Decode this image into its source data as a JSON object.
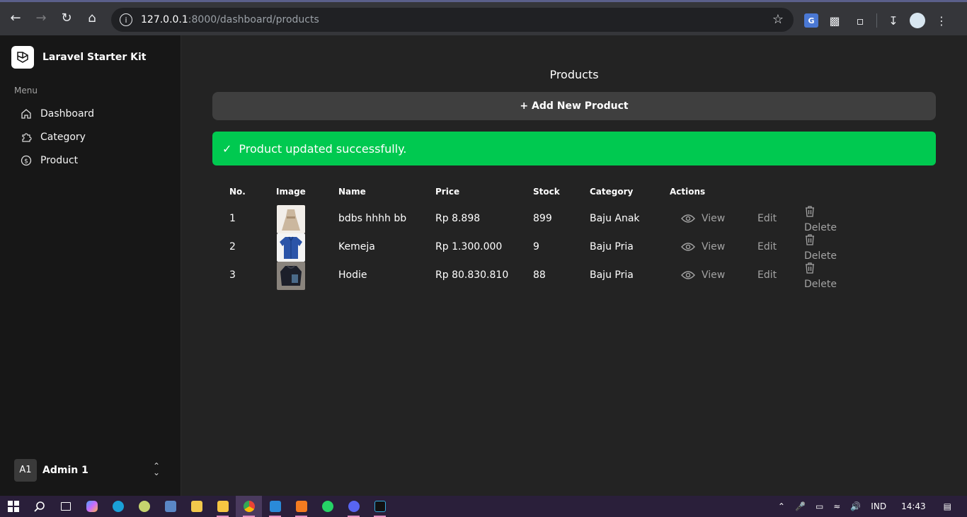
{
  "browser": {
    "url_host": "127.0.0.1",
    "url_path": ":8000/dashboard/products"
  },
  "sidebar": {
    "brand": "Laravel Starter Kit",
    "menu_title": "Menu",
    "items": [
      {
        "label": "Dashboard",
        "icon": "home-icon"
      },
      {
        "label": "Category",
        "icon": "puzzle-icon"
      },
      {
        "label": "Product",
        "icon": "dollar-circle-icon"
      }
    ],
    "user": {
      "initials": "A1",
      "name": "Admin 1"
    }
  },
  "main": {
    "title": "Products",
    "add_button": "+ Add New Product",
    "alert": "Product updated successfully.",
    "columns": [
      "No.",
      "Image",
      "Name",
      "Price",
      "Stock",
      "Category",
      "Actions"
    ],
    "rows": [
      {
        "no": "1",
        "name": "bdbs hhhh bb",
        "price": "Rp 8.898",
        "stock": "899",
        "category": "Baju Anak",
        "image": "beige-dress"
      },
      {
        "no": "2",
        "name": "Kemeja",
        "price": "Rp 1.300.000",
        "stock": "9",
        "category": "Baju Pria",
        "image": "blue-shirt"
      },
      {
        "no": "3",
        "name": "Hodie",
        "price": "Rp 80.830.810",
        "stock": "88",
        "category": "Baju Pria",
        "image": "black-hoodie"
      }
    ],
    "actions": {
      "view": "View",
      "edit": "Edit",
      "delete": "Delete"
    }
  },
  "taskbar": {
    "language": "IND",
    "time": "14:43"
  },
  "colors": {
    "success": "#00c950",
    "sidebar_bg": "#171717",
    "main_bg": "#232323",
    "button_bg": "#3f3f3f"
  }
}
